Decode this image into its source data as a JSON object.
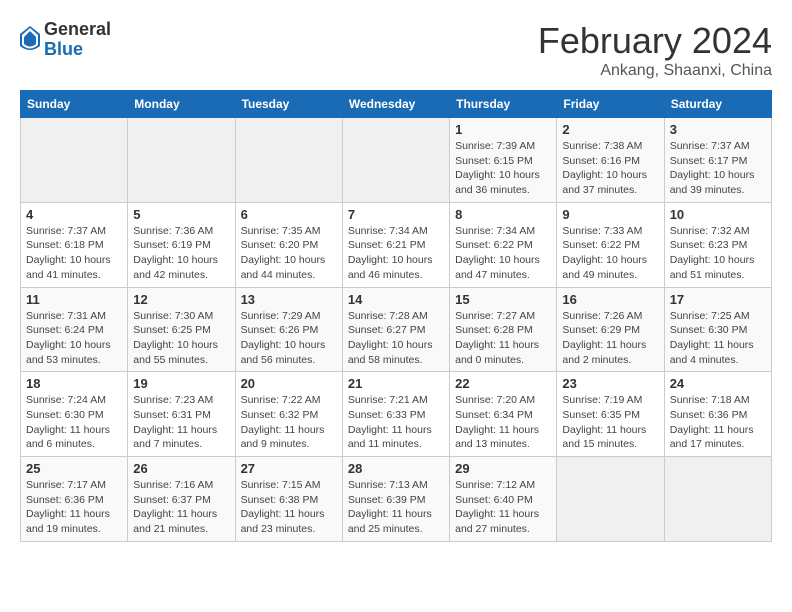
{
  "logo": {
    "general": "General",
    "blue": "Blue"
  },
  "calendar": {
    "title": "February 2024",
    "subtitle": "Ankang, Shaanxi, China"
  },
  "weekdays": [
    "Sunday",
    "Monday",
    "Tuesday",
    "Wednesday",
    "Thursday",
    "Friday",
    "Saturday"
  ],
  "weeks": [
    [
      {
        "day": "",
        "info": ""
      },
      {
        "day": "",
        "info": ""
      },
      {
        "day": "",
        "info": ""
      },
      {
        "day": "",
        "info": ""
      },
      {
        "day": "1",
        "info": "Sunrise: 7:39 AM\nSunset: 6:15 PM\nDaylight: 10 hours\nand 36 minutes."
      },
      {
        "day": "2",
        "info": "Sunrise: 7:38 AM\nSunset: 6:16 PM\nDaylight: 10 hours\nand 37 minutes."
      },
      {
        "day": "3",
        "info": "Sunrise: 7:37 AM\nSunset: 6:17 PM\nDaylight: 10 hours\nand 39 minutes."
      }
    ],
    [
      {
        "day": "4",
        "info": "Sunrise: 7:37 AM\nSunset: 6:18 PM\nDaylight: 10 hours\nand 41 minutes."
      },
      {
        "day": "5",
        "info": "Sunrise: 7:36 AM\nSunset: 6:19 PM\nDaylight: 10 hours\nand 42 minutes."
      },
      {
        "day": "6",
        "info": "Sunrise: 7:35 AM\nSunset: 6:20 PM\nDaylight: 10 hours\nand 44 minutes."
      },
      {
        "day": "7",
        "info": "Sunrise: 7:34 AM\nSunset: 6:21 PM\nDaylight: 10 hours\nand 46 minutes."
      },
      {
        "day": "8",
        "info": "Sunrise: 7:34 AM\nSunset: 6:22 PM\nDaylight: 10 hours\nand 47 minutes."
      },
      {
        "day": "9",
        "info": "Sunrise: 7:33 AM\nSunset: 6:22 PM\nDaylight: 10 hours\nand 49 minutes."
      },
      {
        "day": "10",
        "info": "Sunrise: 7:32 AM\nSunset: 6:23 PM\nDaylight: 10 hours\nand 51 minutes."
      }
    ],
    [
      {
        "day": "11",
        "info": "Sunrise: 7:31 AM\nSunset: 6:24 PM\nDaylight: 10 hours\nand 53 minutes."
      },
      {
        "day": "12",
        "info": "Sunrise: 7:30 AM\nSunset: 6:25 PM\nDaylight: 10 hours\nand 55 minutes."
      },
      {
        "day": "13",
        "info": "Sunrise: 7:29 AM\nSunset: 6:26 PM\nDaylight: 10 hours\nand 56 minutes."
      },
      {
        "day": "14",
        "info": "Sunrise: 7:28 AM\nSunset: 6:27 PM\nDaylight: 10 hours\nand 58 minutes."
      },
      {
        "day": "15",
        "info": "Sunrise: 7:27 AM\nSunset: 6:28 PM\nDaylight: 11 hours\nand 0 minutes."
      },
      {
        "day": "16",
        "info": "Sunrise: 7:26 AM\nSunset: 6:29 PM\nDaylight: 11 hours\nand 2 minutes."
      },
      {
        "day": "17",
        "info": "Sunrise: 7:25 AM\nSunset: 6:30 PM\nDaylight: 11 hours\nand 4 minutes."
      }
    ],
    [
      {
        "day": "18",
        "info": "Sunrise: 7:24 AM\nSunset: 6:30 PM\nDaylight: 11 hours\nand 6 minutes."
      },
      {
        "day": "19",
        "info": "Sunrise: 7:23 AM\nSunset: 6:31 PM\nDaylight: 11 hours\nand 7 minutes."
      },
      {
        "day": "20",
        "info": "Sunrise: 7:22 AM\nSunset: 6:32 PM\nDaylight: 11 hours\nand 9 minutes."
      },
      {
        "day": "21",
        "info": "Sunrise: 7:21 AM\nSunset: 6:33 PM\nDaylight: 11 hours\nand 11 minutes."
      },
      {
        "day": "22",
        "info": "Sunrise: 7:20 AM\nSunset: 6:34 PM\nDaylight: 11 hours\nand 13 minutes."
      },
      {
        "day": "23",
        "info": "Sunrise: 7:19 AM\nSunset: 6:35 PM\nDaylight: 11 hours\nand 15 minutes."
      },
      {
        "day": "24",
        "info": "Sunrise: 7:18 AM\nSunset: 6:36 PM\nDaylight: 11 hours\nand 17 minutes."
      }
    ],
    [
      {
        "day": "25",
        "info": "Sunrise: 7:17 AM\nSunset: 6:36 PM\nDaylight: 11 hours\nand 19 minutes."
      },
      {
        "day": "26",
        "info": "Sunrise: 7:16 AM\nSunset: 6:37 PM\nDaylight: 11 hours\nand 21 minutes."
      },
      {
        "day": "27",
        "info": "Sunrise: 7:15 AM\nSunset: 6:38 PM\nDaylight: 11 hours\nand 23 minutes."
      },
      {
        "day": "28",
        "info": "Sunrise: 7:13 AM\nSunset: 6:39 PM\nDaylight: 11 hours\nand 25 minutes."
      },
      {
        "day": "29",
        "info": "Sunrise: 7:12 AM\nSunset: 6:40 PM\nDaylight: 11 hours\nand 27 minutes."
      },
      {
        "day": "",
        "info": ""
      },
      {
        "day": "",
        "info": ""
      }
    ]
  ]
}
